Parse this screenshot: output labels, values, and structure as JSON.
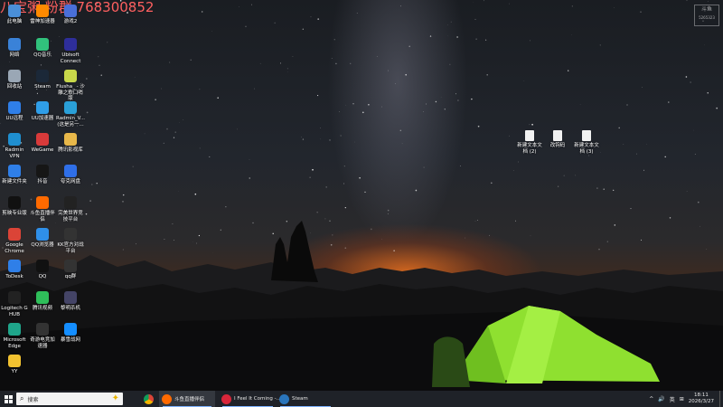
{
  "overlay": {
    "text": "八宝粥 粉群 768300852"
  },
  "corner_logo": {
    "line1": "斗鱼",
    "line2": "5265323"
  },
  "desktop_icons": [
    {
      "label": "此电脑",
      "icon": "computer-icon",
      "color": "#4a8fd8"
    },
    {
      "label": "雷神加速器",
      "icon": "leishen-icon",
      "color": "#ff8a00"
    },
    {
      "label": "游戏2",
      "icon": "folder-icon",
      "color": "#4a6fd8"
    },
    {
      "label": "网络",
      "icon": "network-icon",
      "color": "#3a82d8"
    },
    {
      "label": "QQ音乐",
      "icon": "qqmusic-icon",
      "color": "#31c27c"
    },
    {
      "label": "Ubisoft Connect",
      "icon": "ubisoft-icon",
      "color": "#2e2e9a"
    },
    {
      "label": "回收站",
      "icon": "recycle-bin-icon",
      "color": "#9aa7b5"
    },
    {
      "label": "Steam",
      "icon": "steam-icon",
      "color": "#1b2838"
    },
    {
      "label": "Flusha_ - 沙雕之歌口哨版",
      "icon": "audio-file-icon",
      "color": "#c8d84a"
    },
    {
      "label": "UU远程",
      "icon": "uu-remote-icon",
      "color": "#2f7fe8"
    },
    {
      "label": "UU加速器",
      "icon": "uu-accelerator-icon",
      "color": "#2f9ee8"
    },
    {
      "label": "Radmin_V... (这是另一...",
      "icon": "radmin-icon",
      "color": "#2aa0d8"
    },
    {
      "label": "Radmin VPN",
      "icon": "radmin-vpn-icon",
      "color": "#1f8fd0"
    },
    {
      "label": "WeGame",
      "icon": "wegame-icon",
      "color": "#d83a3a"
    },
    {
      "label": "腾讯影视库",
      "icon": "folder-icon",
      "color": "#e8b84a"
    },
    {
      "label": "新建文件夹",
      "icon": "folder-icon",
      "color": "#2f7fe8"
    },
    {
      "label": "抖音",
      "icon": "douyin-icon",
      "color": "#161616"
    },
    {
      "label": "夸克网盘",
      "icon": "quark-icon",
      "color": "#2f6fe8"
    },
    {
      "label": "剪映专业版",
      "icon": "jianying-icon",
      "color": "#111111"
    },
    {
      "label": "斗鱼直播伴侣",
      "icon": "douyu-icon",
      "color": "#ff6a00"
    },
    {
      "label": "完美世界竞技平台",
      "icon": "perfectworld-icon",
      "color": "#222222"
    },
    {
      "label": "Google Chrome",
      "icon": "chrome-icon",
      "color": "#db4437"
    },
    {
      "label": "QQ浏览器",
      "icon": "qq-browser-icon",
      "color": "#2f8fe8"
    },
    {
      "label": "KK官方对战平台",
      "icon": "kk-icon",
      "color": "#333333"
    },
    {
      "label": "ToDesk",
      "icon": "todesk-icon",
      "color": "#2f7fe8"
    },
    {
      "label": "QQ",
      "icon": "qq-icon",
      "color": "#111111"
    },
    {
      "label": "qq群",
      "icon": "folder-icon",
      "color": "#333333"
    },
    {
      "label": "Logitech G HUB",
      "icon": "logitech-icon",
      "color": "#222222"
    },
    {
      "label": "腾讯视频",
      "icon": "tencent-video-icon",
      "color": "#2fbf5a"
    },
    {
      "label": "黎明杀机",
      "icon": "dbd-icon",
      "color": "#444466"
    },
    {
      "label": "Microsoft Edge",
      "icon": "edge-icon",
      "color": "#1fa58a"
    },
    {
      "label": "奇游电竞加速器",
      "icon": "qiyou-icon",
      "color": "#333333"
    },
    {
      "label": "暴雪战网",
      "icon": "battlenet-icon",
      "color": "#148eff"
    },
    {
      "label": "YY",
      "icon": "yy-icon",
      "color": "#f2c230"
    }
  ],
  "files": [
    {
      "label": "新建文本文档 (2)"
    },
    {
      "label": "改钩码"
    },
    {
      "label": "新建文本文档 (3)"
    }
  ],
  "taskbar": {
    "search_label": "搜索",
    "apps": [
      {
        "title": "",
        "icon": "chrome-icon",
        "color": "#db4437"
      },
      {
        "title": "斗鱼直播伴侣",
        "icon": "douyu-icon",
        "color": "#ff6a00"
      },
      {
        "title": "I Feel It Coming -...",
        "icon": "netease-music-icon",
        "color": "#d8263a"
      },
      {
        "title": "Steam",
        "icon": "steam-icon",
        "color": "#2a75bb"
      }
    ],
    "tray": {
      "chevron": "^",
      "lang": "英",
      "time": "18:11",
      "date": "2026/3/27"
    }
  }
}
